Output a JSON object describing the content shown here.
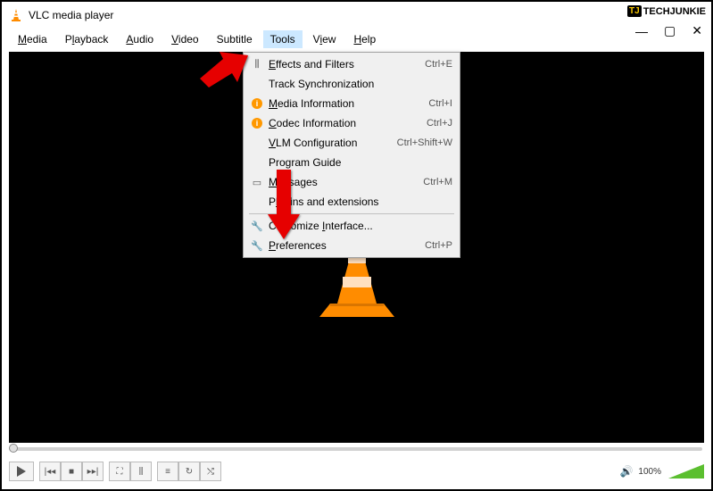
{
  "title": "VLC media player",
  "watermark": "TECHJUNKIE",
  "menubar": [
    {
      "label": "Media",
      "underline_idx": 0,
      "active": false
    },
    {
      "label": "Playback",
      "underline_idx": 1,
      "active": false
    },
    {
      "label": "Audio",
      "underline_idx": 0,
      "active": false
    },
    {
      "label": "Video",
      "underline_idx": 0,
      "active": false
    },
    {
      "label": "Subtitle",
      "underline_idx": -1,
      "active": false
    },
    {
      "label": "Tools",
      "underline_idx": -1,
      "active": true
    },
    {
      "label": "View",
      "underline_idx": 1,
      "active": false
    },
    {
      "label": "Help",
      "underline_idx": 0,
      "active": false
    }
  ],
  "tools_menu": [
    {
      "icon": "sliders",
      "label": "Effects and Filters",
      "u": 0,
      "shortcut": "Ctrl+E"
    },
    {
      "icon": "",
      "label": "Track Synchronization",
      "u": -1,
      "shortcut": ""
    },
    {
      "icon": "info",
      "label": "Media Information",
      "u": 0,
      "shortcut": "Ctrl+I"
    },
    {
      "icon": "info",
      "label": "Codec Information",
      "u": 0,
      "shortcut": "Ctrl+J"
    },
    {
      "icon": "",
      "label": "VLM Configuration",
      "u": 0,
      "shortcut": "Ctrl+Shift+W"
    },
    {
      "icon": "",
      "label": "Program Guide",
      "u": -1,
      "shortcut": ""
    },
    {
      "icon": "msg",
      "label": "Messages",
      "u": 0,
      "shortcut": "Ctrl+M"
    },
    {
      "icon": "",
      "label": "Plugins and extensions",
      "u": 1,
      "shortcut": ""
    },
    {
      "sep": true
    },
    {
      "icon": "wrench",
      "label": "Customize Interface...",
      "u": 10,
      "shortcut": ""
    },
    {
      "icon": "wrench",
      "label": "Preferences",
      "u": 0,
      "shortcut": "Ctrl+P"
    }
  ],
  "volume": "100%"
}
